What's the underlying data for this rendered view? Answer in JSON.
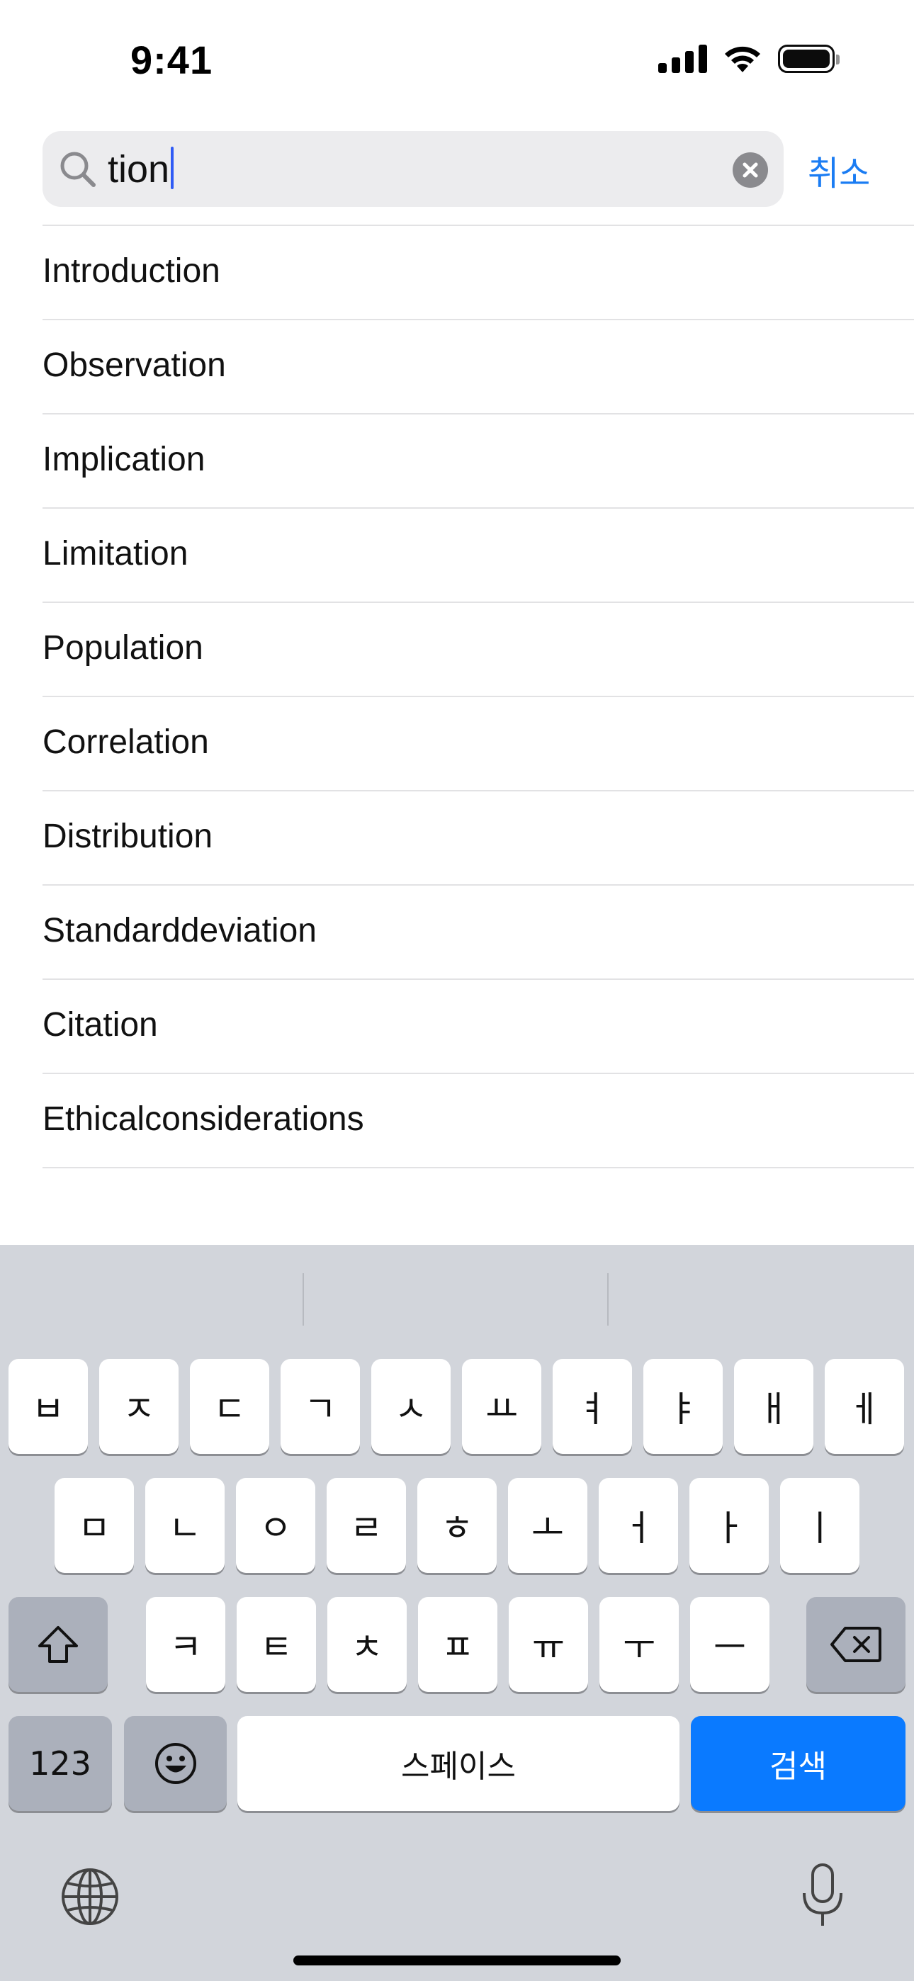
{
  "status_bar": {
    "time": "9:41",
    "icons": [
      "cellular-signal-icon",
      "wifi-icon",
      "battery-icon"
    ]
  },
  "search": {
    "query": "tion",
    "icon": "search-icon",
    "clear_icon": "clear-icon",
    "cancel_label": "취소"
  },
  "results": [
    {
      "label": "Introduction"
    },
    {
      "label": "Observation"
    },
    {
      "label": "Implication"
    },
    {
      "label": "Limitation"
    },
    {
      "label": "Population"
    },
    {
      "label": "Correlation"
    },
    {
      "label": "Distribution"
    },
    {
      "label": "Standarddeviation"
    },
    {
      "label": "Citation"
    },
    {
      "label": "Ethicalconsiderations"
    }
  ],
  "keyboard": {
    "row1": [
      "ㅂ",
      "ㅈ",
      "ㄷ",
      "ㄱ",
      "ㅅ",
      "ㅛ",
      "ㅕ",
      "ㅑ",
      "ㅐ",
      "ㅔ"
    ],
    "row2": [
      "ㅁ",
      "ㄴ",
      "ㅇ",
      "ㄹ",
      "ㅎ",
      "ㅗ",
      "ㅓ",
      "ㅏ",
      "ㅣ"
    ],
    "row3": [
      "ㅋ",
      "ㅌ",
      "ㅊ",
      "ㅍ",
      "ㅠ",
      "ㅜ",
      "ㅡ"
    ],
    "numbers_label": "123",
    "space_label": "스페이스",
    "search_label": "검색",
    "colors": {
      "background": "#d2d5db",
      "key": "#ffffff",
      "function_key": "#abb0bb",
      "action_key": "#0a7aff"
    }
  },
  "colors": {
    "accent": "#1a7cf3",
    "caret": "#2f5bf5"
  }
}
